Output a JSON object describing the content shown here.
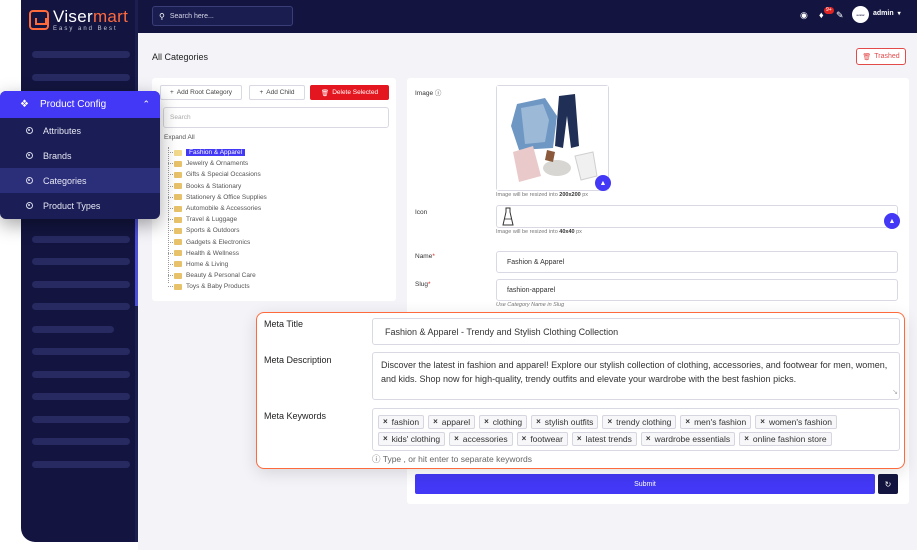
{
  "brand": {
    "name_part1": "Viser",
    "name_part2": "mart",
    "tagline": "Easy and Best"
  },
  "topbar": {
    "search_placeholder": "Search here...",
    "notification_count": "9+",
    "avatar_text": "avatar",
    "user_name": "admin"
  },
  "menu": {
    "title": "Product Config",
    "items": [
      {
        "label": "Attributes",
        "active": false
      },
      {
        "label": "Brands",
        "active": false
      },
      {
        "label": "Categories",
        "active": true
      },
      {
        "label": "Product Types",
        "active": false
      }
    ]
  },
  "page": {
    "title": "All Categories",
    "trashed_label": "Trashed"
  },
  "tree": {
    "add_root_label": "Add Root Category",
    "add_child_label": "Add Child",
    "delete_label": "Delete Selected",
    "search_placeholder": "Search",
    "expand_all_label": "Expand All",
    "categories": [
      "Fashion & Apparel",
      "Jewelry & Ornaments",
      "Gifts & Special Occasions",
      "Books & Stationary",
      "Stationery & Office Supplies",
      "Automobile & Accessories",
      "Travel & Luggage",
      "Sports & Outdoors",
      "Gadgets & Electronics",
      "Health & Wellness",
      "Home & Living",
      "Beauty & Personal Care",
      "Toys & Baby Products"
    ],
    "selected": "Fashion & Apparel"
  },
  "form": {
    "image_label": "Image",
    "image_hint_prefix": "Image will be resized into ",
    "image_hint_size": "200x200",
    "image_hint_suffix": " px",
    "icon_label": "Icon",
    "icon_hint_prefix": "Image will be resized into ",
    "icon_hint_size": "40x40",
    "icon_hint_suffix": " px",
    "name_label": "Name",
    "name_value": "Fashion & Apparel",
    "slug_label": "Slug",
    "slug_value": "fashion-apparel",
    "slug_hint": "Use Category Name in Slug",
    "submit_label": "Submit"
  },
  "meta": {
    "title_label": "Meta Title",
    "title_value": "Fashion & Apparel - Trendy and Stylish Clothing Collection",
    "description_label": "Meta Description",
    "description_value": "Discover the latest in fashion and apparel! Explore our stylish collection of clothing, accessories, and footwear for men, women, and kids. Shop now for high-quality, trendy outfits and elevate your wardrobe with the best fashion picks.",
    "keywords_label": "Meta Keywords",
    "keywords": [
      "fashion",
      "apparel",
      "clothing",
      "stylish outfits",
      "trendy clothing",
      "men's fashion",
      "women's fashion",
      "kids' clothing",
      "accessories",
      "footwear",
      "latest trends",
      "wardrobe essentials",
      "online fashion store"
    ],
    "keywords_hint": "Type , or hit enter to separate keywords"
  },
  "colors": {
    "sidebar": "#131540",
    "accent": "#4338f5",
    "brand_orange": "#ff6a3d",
    "danger": "#e4161f"
  },
  "icons": {
    "search": "search-icon",
    "globe": "globe-icon",
    "bell": "bell-icon",
    "wrench": "wrench-icon",
    "cube": "cube-icon",
    "upload": "cloud-upload-icon",
    "refresh": "refresh-icon"
  }
}
